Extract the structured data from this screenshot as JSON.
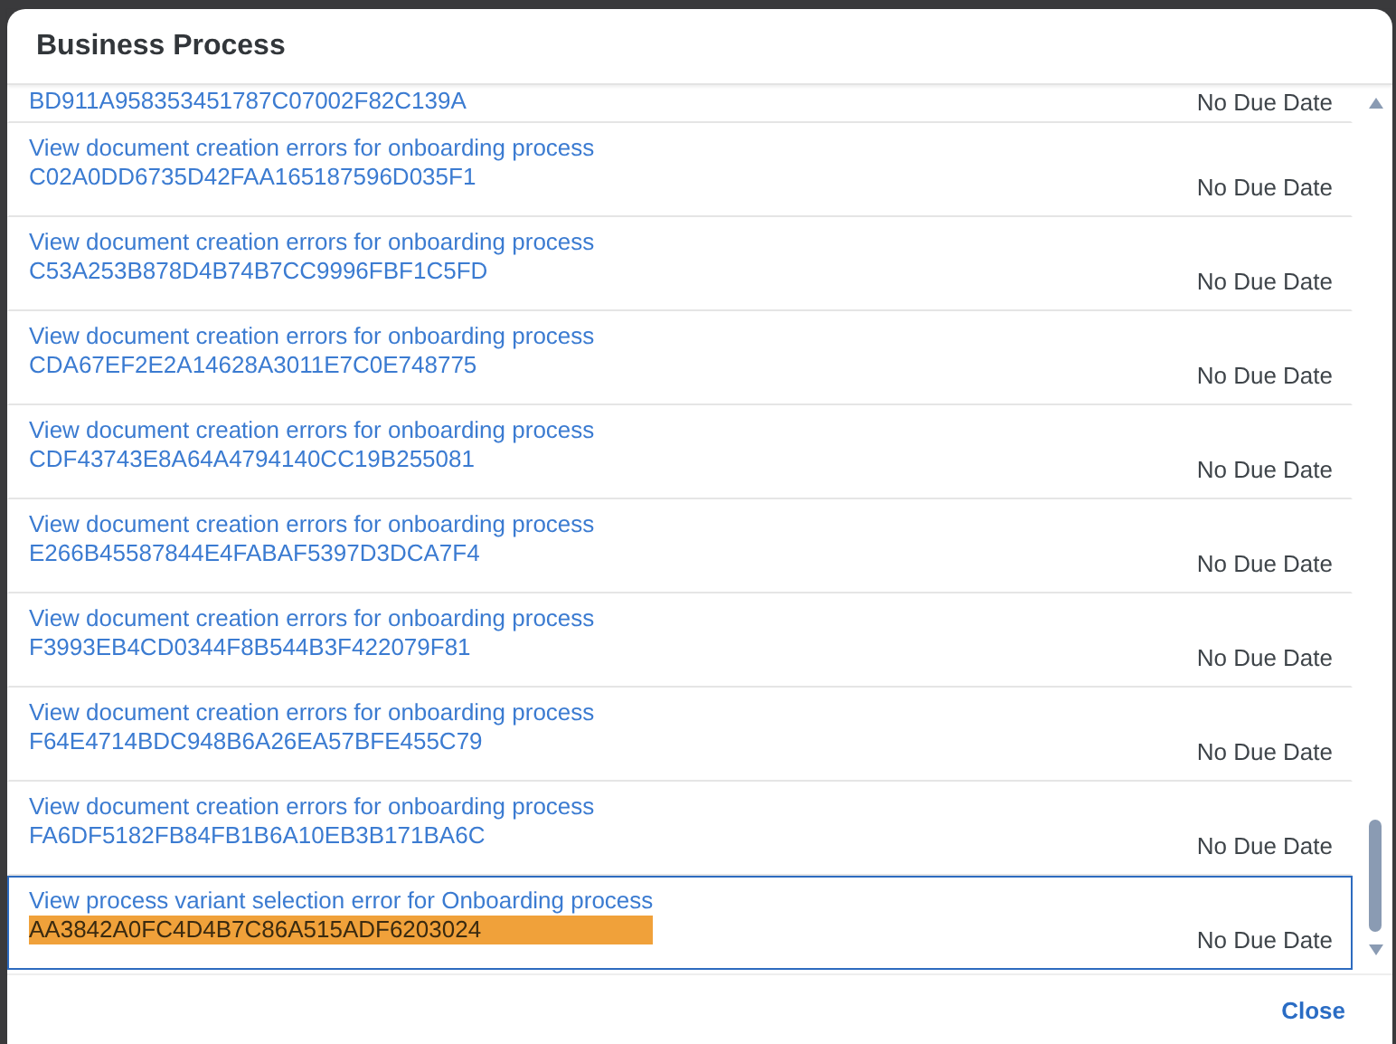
{
  "dialog": {
    "title": "Business Process",
    "close_label": "Close"
  },
  "rows": [
    {
      "title": "",
      "id": "BD911A958353451787C07002F82C139A",
      "due": "No Due Date",
      "selected": false,
      "highlighted": false
    },
    {
      "title": "View document creation errors for onboarding process",
      "id": "C02A0DD6735D42FAA165187596D035F1",
      "due": "No Due Date",
      "selected": false,
      "highlighted": false
    },
    {
      "title": "View document creation errors for onboarding process",
      "id": "C53A253B878D4B74B7CC9996FBF1C5FD",
      "due": "No Due Date",
      "selected": false,
      "highlighted": false
    },
    {
      "title": "View document creation errors for onboarding process",
      "id": "CDA67EF2E2A14628A3011E7C0E748775",
      "due": "No Due Date",
      "selected": false,
      "highlighted": false
    },
    {
      "title": "View document creation errors for onboarding process",
      "id": "CDF43743E8A64A4794140CC19B255081",
      "due": "No Due Date",
      "selected": false,
      "highlighted": false
    },
    {
      "title": "View document creation errors for onboarding process",
      "id": "E266B45587844E4FABAF5397D3DCA7F4",
      "due": "No Due Date",
      "selected": false,
      "highlighted": false
    },
    {
      "title": "View document creation errors for onboarding process",
      "id": "F3993EB4CD0344F8B544B3F422079F81",
      "due": "No Due Date",
      "selected": false,
      "highlighted": false
    },
    {
      "title": "View document creation errors for onboarding process",
      "id": "F64E4714BDC948B6A26EA57BFE455C79",
      "due": "No Due Date",
      "selected": false,
      "highlighted": false
    },
    {
      "title": "View document creation errors for onboarding process",
      "id": "FA6DF5182FB84FB1B6A10EB3B171BA6C",
      "due": "No Due Date",
      "selected": false,
      "highlighted": false
    },
    {
      "title": "View process variant selection error for Onboarding process",
      "id": "AA3842A0FC4D4B7C86A515ADF6203024",
      "due": "No Due Date",
      "selected": true,
      "highlighted": true
    }
  ]
}
